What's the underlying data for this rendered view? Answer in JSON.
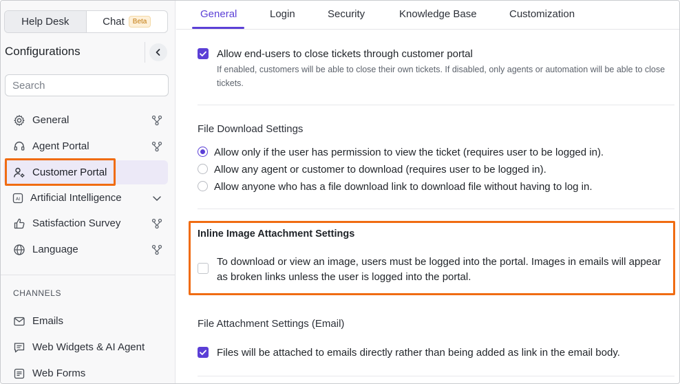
{
  "sidebar": {
    "switcher": {
      "helpdesk": "Help Desk",
      "chat": "Chat",
      "beta": "Beta"
    },
    "title": "Configurations",
    "search_placeholder": "Search",
    "items": [
      {
        "label": "General",
        "icon": "gear-icon",
        "trailing": "branch-icon"
      },
      {
        "label": "Agent Portal",
        "icon": "headset-icon",
        "trailing": "branch-icon"
      },
      {
        "label": "Customer Portal",
        "icon": "user-gear-icon",
        "selected": true
      },
      {
        "label": "Artificial Intelligence",
        "icon": "ai-icon",
        "trailing": "chevron-down-icon"
      },
      {
        "label": "Satisfaction Survey",
        "icon": "thumbs-up-icon",
        "trailing": "branch-icon"
      },
      {
        "label": "Language",
        "icon": "globe-icon",
        "trailing": "branch-icon"
      }
    ],
    "channels_label": "CHANNELS",
    "channels": [
      {
        "label": "Emails",
        "icon": "mail-icon"
      },
      {
        "label": "Web Widgets & AI Agent",
        "icon": "chat-icon"
      },
      {
        "label": "Web Forms",
        "icon": "form-icon"
      }
    ]
  },
  "tabs": [
    "General",
    "Login",
    "Security",
    "Knowledge Base",
    "Customization"
  ],
  "main": {
    "close_tickets": {
      "label": "Allow end-users to close tickets through customer portal",
      "help": "If enabled, customers will be able to close their own tickets. If disabled, only agents or automation will be able to close tickets.",
      "checked": true
    },
    "file_download": {
      "heading": "File Download Settings",
      "options": [
        "Allow only if the user has permission to view the ticket (requires user to be logged in).",
        "Allow any agent or customer to download (requires user to be logged in).",
        "Allow anyone who has a file download link to download file without having to log in."
      ],
      "selected_index": 0
    },
    "inline_image": {
      "heading": "Inline Image Attachment Settings",
      "label": "To download or view an image, users must be logged into the portal. Images in emails will appear as broken links unless the user is logged into the portal.",
      "checked": false
    },
    "file_attachment": {
      "heading": "File Attachment Settings (Email)",
      "label": "Files will be attached to emails directly rather than being added as link in the email body.",
      "checked": true
    }
  },
  "colors": {
    "accent": "#5b3fd6",
    "highlight": "#f06c12"
  }
}
